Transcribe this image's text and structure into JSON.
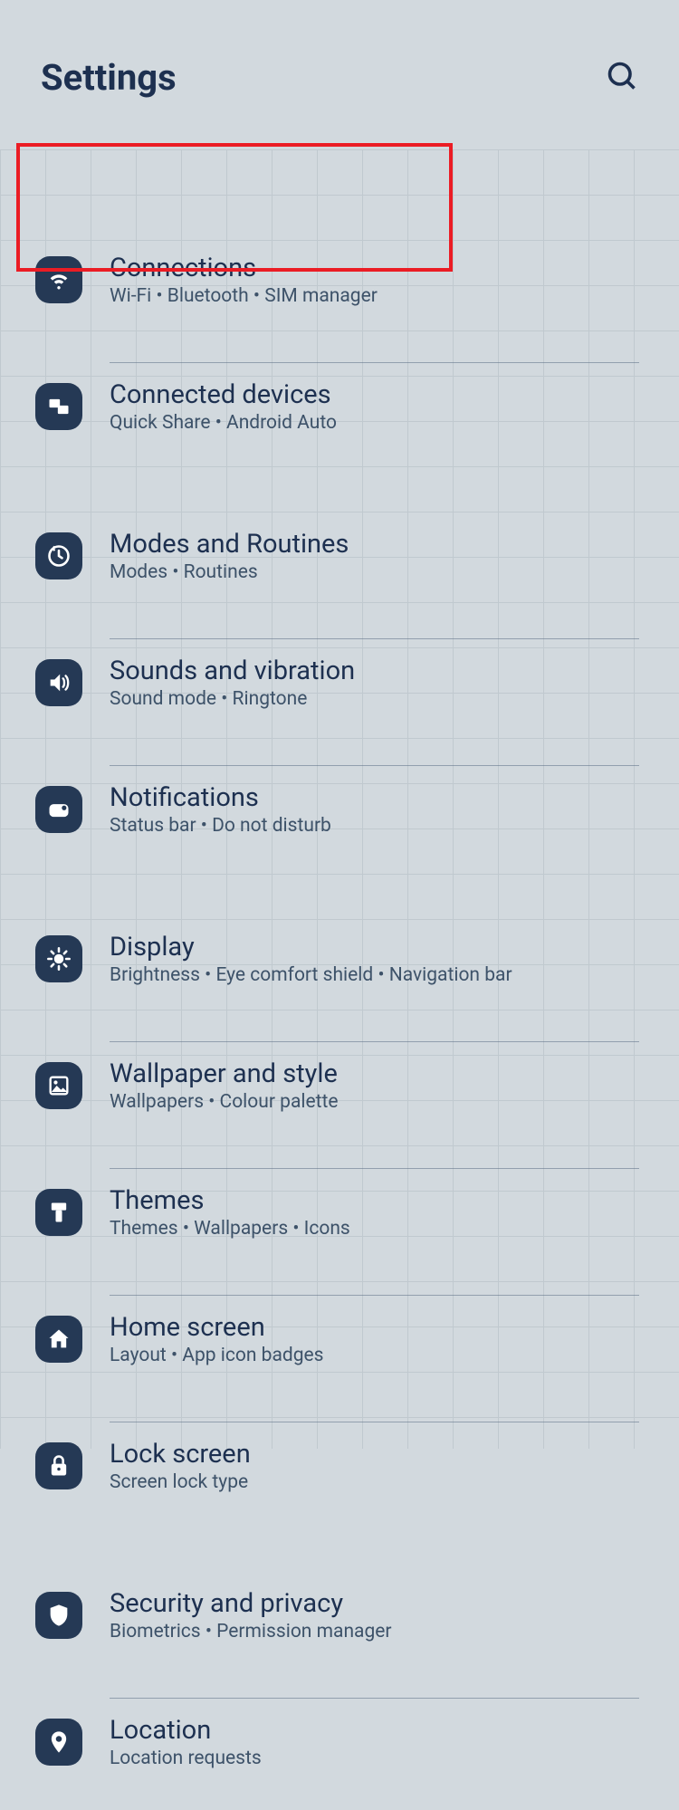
{
  "header": {
    "title": "Settings"
  },
  "groups": [
    {
      "items": [
        {
          "id": "connections",
          "icon": "wifi",
          "title": "Connections",
          "subtitle": "Wi-Fi  •  Bluetooth  •  SIM manager",
          "divider": true
        },
        {
          "id": "connected-devices",
          "icon": "devices",
          "title": "Connected devices",
          "subtitle": "Quick Share  •  Android Auto",
          "divider": false
        }
      ]
    },
    {
      "items": [
        {
          "id": "modes-routines",
          "icon": "modes",
          "title": "Modes and Routines",
          "subtitle": "Modes  •  Routines",
          "divider": true
        },
        {
          "id": "sounds-vibration",
          "icon": "sound",
          "title": "Sounds and vibration",
          "subtitle": "Sound mode  •  Ringtone",
          "divider": true
        },
        {
          "id": "notifications",
          "icon": "notifications",
          "title": "Notifications",
          "subtitle": "Status bar  •  Do not disturb",
          "divider": false
        }
      ]
    },
    {
      "items": [
        {
          "id": "display",
          "icon": "display",
          "title": "Display",
          "subtitle": "Brightness  •  Eye comfort shield  •  Navigation bar",
          "divider": true
        },
        {
          "id": "wallpaper-style",
          "icon": "wallpaper",
          "title": "Wallpaper and style",
          "subtitle": "Wallpapers  •  Colour palette",
          "divider": true
        },
        {
          "id": "themes",
          "icon": "themes",
          "title": "Themes",
          "subtitle": "Themes  •  Wallpapers  •  Icons",
          "divider": true
        },
        {
          "id": "home-screen",
          "icon": "home",
          "title": "Home screen",
          "subtitle": "Layout  •  App icon badges",
          "divider": true
        },
        {
          "id": "lock-screen",
          "icon": "lock",
          "title": "Lock screen",
          "subtitle": "Screen lock type",
          "divider": false
        }
      ]
    },
    {
      "items": [
        {
          "id": "security-privacy",
          "icon": "shield",
          "title": "Security and privacy",
          "subtitle": "Biometrics  •  Permission manager",
          "divider": true
        },
        {
          "id": "location",
          "icon": "location",
          "title": "Location",
          "subtitle": "Location requests",
          "divider": false
        }
      ]
    }
  ],
  "highlight": "connections"
}
